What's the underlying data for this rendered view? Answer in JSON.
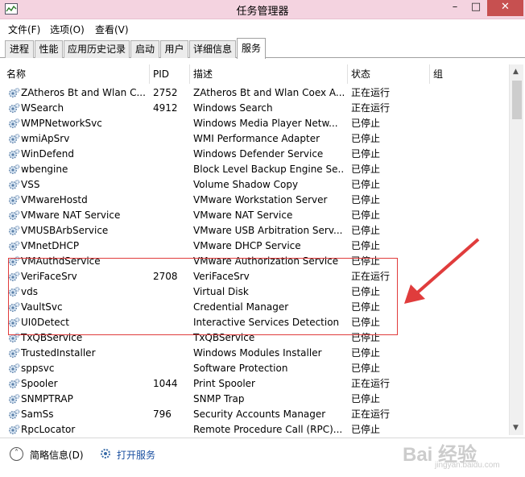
{
  "window": {
    "title": "任务管理器"
  },
  "menu": [
    "文件(F)",
    "选项(O)",
    "查看(V)"
  ],
  "tabs": [
    "进程",
    "性能",
    "应用历史记录",
    "启动",
    "用户",
    "详细信息",
    "服务"
  ],
  "columns": {
    "name": "名称",
    "pid": "PID",
    "desc": "描述",
    "status": "状态",
    "group": "组"
  },
  "rows": [
    {
      "name": "ZAtheros Bt and Wlan C...",
      "pid": "2752",
      "desc": "ZAtheros Bt and Wlan Coex A...",
      "status": "正在运行"
    },
    {
      "name": "WSearch",
      "pid": "4912",
      "desc": "Windows Search",
      "status": "正在运行"
    },
    {
      "name": "WMPNetworkSvc",
      "pid": "",
      "desc": "Windows Media Player Netw...",
      "status": "已停止"
    },
    {
      "name": "wmiApSrv",
      "pid": "",
      "desc": "WMI Performance Adapter",
      "status": "已停止"
    },
    {
      "name": "WinDefend",
      "pid": "",
      "desc": "Windows Defender Service",
      "status": "已停止"
    },
    {
      "name": "wbengine",
      "pid": "",
      "desc": "Block Level Backup Engine Se...",
      "status": "已停止"
    },
    {
      "name": "VSS",
      "pid": "",
      "desc": "Volume Shadow Copy",
      "status": "已停止"
    },
    {
      "name": "VMwareHostd",
      "pid": "",
      "desc": "VMware Workstation Server",
      "status": "已停止"
    },
    {
      "name": "VMware NAT Service",
      "pid": "",
      "desc": "VMware NAT Service",
      "status": "已停止"
    },
    {
      "name": "VMUSBArbService",
      "pid": "",
      "desc": "VMware USB Arbitration Serv...",
      "status": "已停止"
    },
    {
      "name": "VMnetDHCP",
      "pid": "",
      "desc": "VMware DHCP Service",
      "status": "已停止"
    },
    {
      "name": "VMAuthdService",
      "pid": "",
      "desc": "VMware Authorization Service",
      "status": "已停止"
    },
    {
      "name": "VeriFaceSrv",
      "pid": "2708",
      "desc": "VeriFaceSrv",
      "status": "正在运行"
    },
    {
      "name": "vds",
      "pid": "",
      "desc": "Virtual Disk",
      "status": "已停止"
    },
    {
      "name": "VaultSvc",
      "pid": "",
      "desc": "Credential Manager",
      "status": "已停止"
    },
    {
      "name": "UI0Detect",
      "pid": "",
      "desc": "Interactive Services Detection",
      "status": "已停止"
    },
    {
      "name": "TxQBService",
      "pid": "",
      "desc": "TxQBService",
      "status": "已停止"
    },
    {
      "name": "TrustedInstaller",
      "pid": "",
      "desc": "Windows Modules Installer",
      "status": "已停止"
    },
    {
      "name": "sppsvc",
      "pid": "",
      "desc": "Software Protection",
      "status": "已停止"
    },
    {
      "name": "Spooler",
      "pid": "1044",
      "desc": "Print Spooler",
      "status": "正在运行"
    },
    {
      "name": "SNMPTRAP",
      "pid": "",
      "desc": "SNMP Trap",
      "status": "已停止"
    },
    {
      "name": "SamSs",
      "pid": "796",
      "desc": "Security Accounts Manager",
      "status": "正在运行"
    },
    {
      "name": "RpcLocator",
      "pid": "",
      "desc": "Remote Procedure Call (RPC)...",
      "status": "已停止"
    }
  ],
  "footer": {
    "less_details": "简略信息(D)",
    "open_services": "打开服务"
  },
  "watermark": {
    "main": "Bai 经验",
    "sub": "jingyan.baidu.com"
  },
  "colors": {
    "titlebar": "#f4d3e0",
    "close_button": "#c75050",
    "highlight": "#e03c3c",
    "link": "#1a4fa0"
  }
}
